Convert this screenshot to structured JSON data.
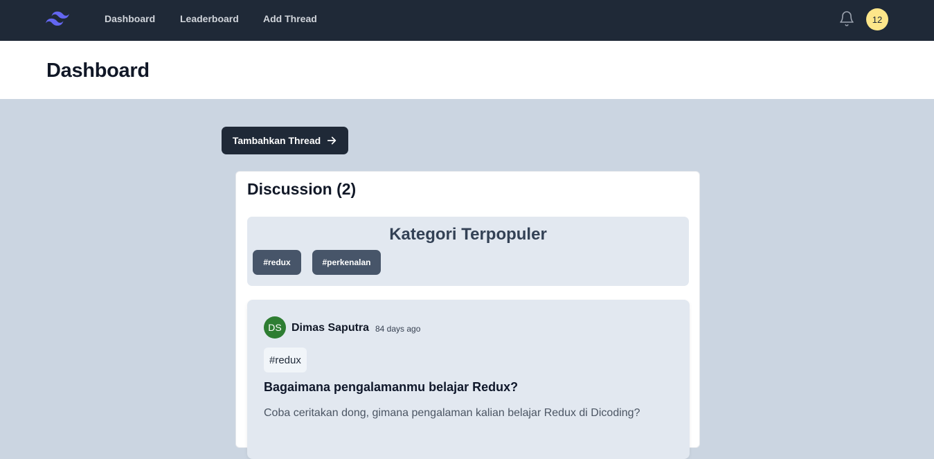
{
  "nav": {
    "logo_icon": "tailwind-logo-icon",
    "links": [
      "Dashboard",
      "Leaderboard",
      "Add Thread"
    ],
    "bell_icon": "bell-icon",
    "avatar_text": "12"
  },
  "header": {
    "title": "Dashboard"
  },
  "actions": {
    "add_thread_label": "Tambahkan Thread",
    "add_thread_icon": "arrow-right-icon"
  },
  "discussion": {
    "title": "Discussion (2)",
    "popular_categories": {
      "title": "Kategori Terpopuler",
      "tags": [
        "#redux",
        "#perkenalan"
      ]
    },
    "threads": [
      {
        "owner_initials": "DS",
        "owner_name": "Dimas Saputra",
        "created_at": "84 days ago",
        "category": "#redux",
        "title": "Bagaimana pengalamanmu belajar Redux?",
        "body": "Coba ceritakan dong, gimana pengalaman kalian belajar Redux di Dicoding?"
      }
    ]
  },
  "colors": {
    "navbar": "#1f2937",
    "page_bg": "#cbd5e1",
    "category_bg": "#e2e8f0",
    "tag_bg": "#475569",
    "avatar_badge": "#fde68a",
    "owner_avatar": "#2e7d32",
    "logo": "#6366f1"
  }
}
